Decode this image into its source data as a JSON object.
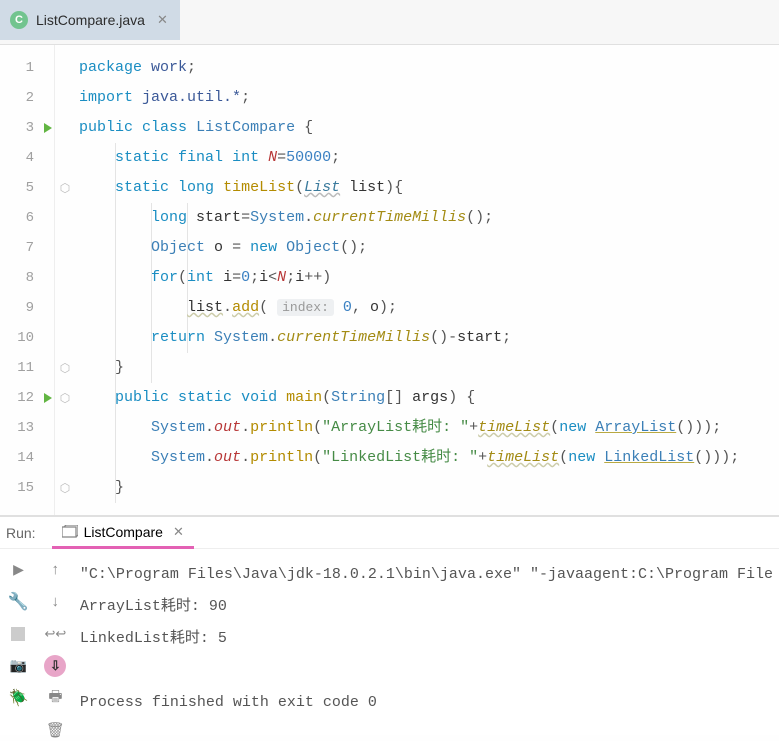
{
  "tab": {
    "filename": "ListCompare.java",
    "icon_letter": "C"
  },
  "editor": {
    "line_numbers": [
      "1",
      "2",
      "3",
      "4",
      "5",
      "6",
      "7",
      "8",
      "9",
      "10",
      "11",
      "12",
      "13",
      "14",
      "15"
    ],
    "code": {
      "l1": {
        "kw1": "package",
        "name": "work",
        "sc": ";"
      },
      "l2": {
        "kw1": "import",
        "pkg": "java.util.*",
        "sc": ";"
      },
      "l3": {
        "kw1": "public",
        "kw2": "class",
        "cls": "ListCompare",
        "br": " {"
      },
      "l4": {
        "kw1": "static",
        "kw2": "final",
        "kw3": "int",
        "name": "N",
        "eq": "=",
        "val": "50000",
        "sc": ";"
      },
      "l5": {
        "kw1": "static",
        "kw2": "long",
        "mname": "timeList",
        "p1": "(",
        "ptype": "List",
        "pname": "list",
        "p2": "){"
      },
      "l6": {
        "kw1": "long",
        "var": "start",
        "eq": "=",
        "cls": "System",
        "dot": ".",
        "mcall": "currentTimeMillis",
        "p": "();"
      },
      "l7": {
        "cls": "Object",
        "var": "o",
        "eq": " = ",
        "kw": "new",
        "cls2": "Object",
        "p": "();"
      },
      "l8": {
        "kw": "for",
        "p1": "(",
        "kw2": "int",
        "var": "i",
        "eq": "=",
        "z": "0",
        "sc1": ";",
        "var2": "i",
        "lt": "<",
        "n": "N",
        "sc2": ";",
        "var3": "i",
        "pp": "++)"
      },
      "l9": {
        "obj": "list",
        "dot": ".",
        "m": "add",
        "p1": "( ",
        "inlay": "index:",
        "sp": " ",
        "z": "0",
        "cm": ", ",
        "o": "o",
        "p2": ");"
      },
      "l10": {
        "kw": "return",
        "cls": "System",
        "dot": ".",
        "mcall": "currentTimeMillis",
        "p": "()-",
        "var": "start",
        "sc": ";"
      },
      "l11": {
        "br": "}"
      },
      "l12": {
        "kw1": "public",
        "kw2": "static",
        "kw3": "void",
        "mname": "main",
        "p1": "(",
        "ptype": "String",
        "arr": "[] ",
        "pname": "args",
        "p2": ") {"
      },
      "l13": {
        "cls": "System",
        "dot1": ".",
        "out": "out",
        "dot2": ".",
        "m": "println",
        "p1": "(",
        "str": "\"ArrayList耗时: \"",
        "plus": "+",
        "fn": "timeList",
        "p2": "(",
        "kw": "new",
        "sp": " ",
        "ctor": "ArrayList",
        "p3": "()));"
      },
      "l14": {
        "cls": "System",
        "dot1": ".",
        "out": "out",
        "dot2": ".",
        "m": "println",
        "p1": "(",
        "str": "\"LinkedList耗时: \"",
        "plus": "+",
        "fn": "timeList",
        "p2": "(",
        "kw": "new",
        "sp": " ",
        "ctor": "LinkedList",
        "p3": "()));"
      },
      "l15": {
        "br": "}"
      }
    }
  },
  "run": {
    "label": "Run:",
    "tab_name": "ListCompare",
    "console": {
      "cmd": "\"C:\\Program Files\\Java\\jdk-18.0.2.1\\bin\\java.exe\" \"-javaagent:C:\\Program File",
      "out1": "ArrayList耗时: 90",
      "out2": "LinkedList耗时: 5",
      "exit": "Process finished with exit code 0"
    }
  }
}
